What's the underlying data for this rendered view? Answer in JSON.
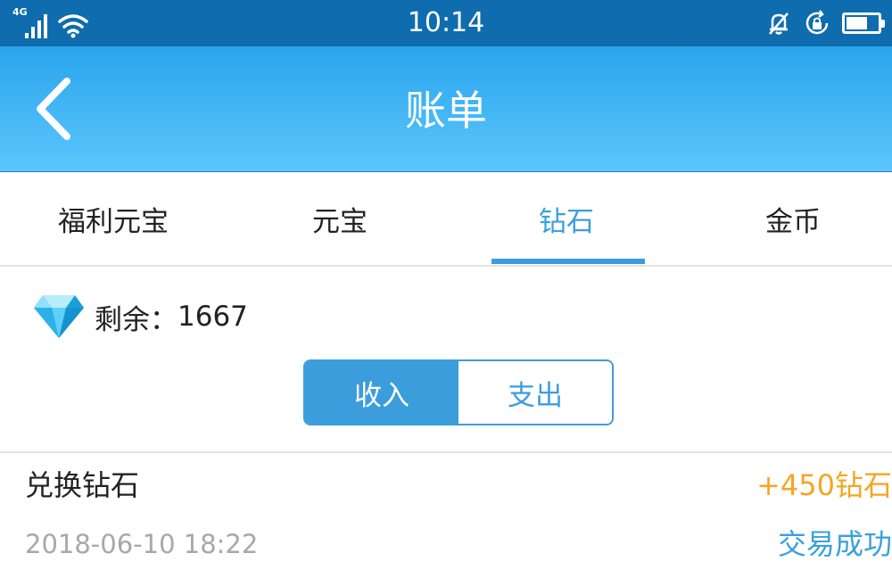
{
  "status_bar": {
    "network_type": "4G",
    "time": "10:14",
    "icons": [
      "signal-icon",
      "wifi-icon",
      "bell-muted-icon",
      "rotation-lock-icon",
      "battery-icon"
    ]
  },
  "header": {
    "title": "账单",
    "back_icon": "chevron-left-icon"
  },
  "tabs": [
    {
      "label": "福利元宝",
      "active": false
    },
    {
      "label": "元宝",
      "active": false
    },
    {
      "label": "钻石",
      "active": true
    },
    {
      "label": "金币",
      "active": false
    }
  ],
  "balance": {
    "icon": "diamond-icon",
    "label": "剩余：",
    "value": "1667"
  },
  "segmented": {
    "options": [
      "收入",
      "支出"
    ],
    "selected": "收入"
  },
  "records": [
    {
      "title": "兑换钻石",
      "time": "2018-06-10 18:22",
      "amount": "+450钻石",
      "status": "交易成功"
    }
  ],
  "colors": {
    "status_bar": "#0f6cae",
    "header_top": "#2aa5ee",
    "header_bottom": "#5cc6fb",
    "accent": "#3c9ddc",
    "amount": "#f5a623",
    "muted_text": "#a8a8a8"
  }
}
